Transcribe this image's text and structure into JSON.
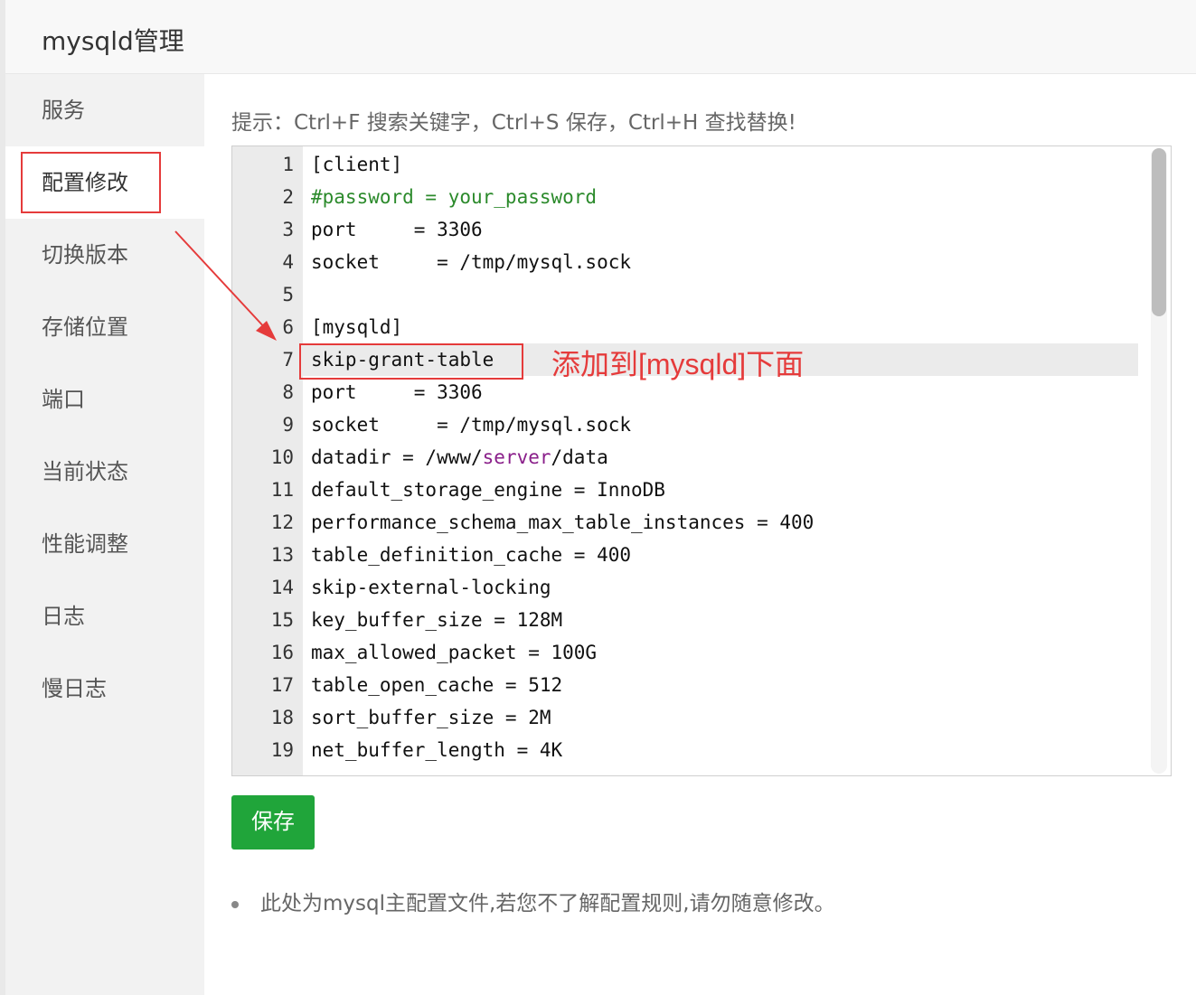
{
  "title": "mysqld管理",
  "sidebar": {
    "items": [
      {
        "label": "服务"
      },
      {
        "label": "配置修改"
      },
      {
        "label": "切换版本"
      },
      {
        "label": "存储位置"
      },
      {
        "label": "端口"
      },
      {
        "label": "当前状态"
      },
      {
        "label": "性能调整"
      },
      {
        "label": "日志"
      },
      {
        "label": "慢日志"
      }
    ],
    "active_index": 1
  },
  "hint": "提示：Ctrl+F 搜索关键字，Ctrl+S 保存，Ctrl+H 查找替换!",
  "editor": {
    "current_line": 7,
    "lines": [
      {
        "n": "1",
        "code": "[client]"
      },
      {
        "n": "2",
        "code": "#password = your_password"
      },
      {
        "n": "3",
        "code": "port     = 3306"
      },
      {
        "n": "4",
        "code": "socket     = /tmp/mysql.sock"
      },
      {
        "n": "5",
        "code": ""
      },
      {
        "n": "6",
        "code": "[mysqld]"
      },
      {
        "n": "7",
        "code": "skip-grant-table"
      },
      {
        "n": "8",
        "code": "port     = 3306"
      },
      {
        "n": "9",
        "code": "socket     = /tmp/mysql.sock"
      },
      {
        "n": "10",
        "code_parts": [
          "datadir = /www/",
          "server",
          "/data"
        ]
      },
      {
        "n": "11",
        "code": "default_storage_engine = InnoDB"
      },
      {
        "n": "12",
        "code": "performance_schema_max_table_instances = 400"
      },
      {
        "n": "13",
        "code": "table_definition_cache = 400"
      },
      {
        "n": "14",
        "code": "skip-external-locking"
      },
      {
        "n": "15",
        "code": "key_buffer_size = 128M"
      },
      {
        "n": "16",
        "code": "max_allowed_packet = 100G"
      },
      {
        "n": "17",
        "code": "table_open_cache = 512"
      },
      {
        "n": "18",
        "code": "sort_buffer_size = 2M"
      },
      {
        "n": "19",
        "code": "net_buffer_length = 4K"
      }
    ]
  },
  "annotation": "添加到[mysqld]下面",
  "save_label": "保存",
  "note": "此处为mysql主配置文件,若您不了解配置规则,请勿随意修改。",
  "colors": {
    "accent": "#20a53a",
    "annotation": "#e53b3b",
    "comment": "#2b8a2b",
    "keyword": "#8a1f8a"
  }
}
